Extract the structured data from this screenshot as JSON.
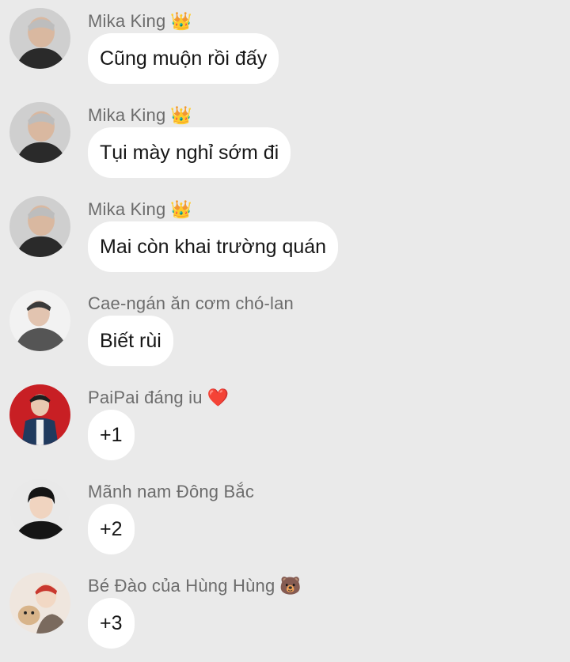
{
  "messages": [
    {
      "sender": "Mika King",
      "badge": "👑",
      "badge_icon": "crown-icon",
      "text": "Cũng muộn rồi đấy",
      "avatar_colors": [
        "#cfcfcf",
        "#2a2a2a",
        "#d9b8a0"
      ]
    },
    {
      "sender": "Mika King",
      "badge": "👑",
      "badge_icon": "crown-icon",
      "text": "Tụi mày nghỉ sớm đi",
      "avatar_colors": [
        "#cfcfcf",
        "#2a2a2a",
        "#d9b8a0"
      ]
    },
    {
      "sender": "Mika King",
      "badge": "👑",
      "badge_icon": "crown-icon",
      "text": "Mai còn khai trường quán",
      "avatar_colors": [
        "#cfcfcf",
        "#2a2a2a",
        "#d9b8a0"
      ]
    },
    {
      "sender": "Cae-ngán ăn cơm chó-lan",
      "badge": "",
      "badge_icon": "",
      "text": "Biết rùi",
      "avatar_colors": [
        "#f2f2f2",
        "#555555",
        "#e2c4b0"
      ]
    },
    {
      "sender": "PaiPai đáng iu",
      "badge": "❤️",
      "badge_icon": "heart-icon",
      "text": "+1",
      "avatar_colors": [
        "#c81f24",
        "#203a5e",
        "#e8c8b0"
      ]
    },
    {
      "sender": "Mãnh nam Đông Bắc",
      "badge": "",
      "badge_icon": "",
      "text": "+2",
      "avatar_colors": [
        "#e9e9e9",
        "#151515",
        "#f0d4c0"
      ]
    },
    {
      "sender": "Bé Đào của Hùng Hùng",
      "badge": "🐻",
      "badge_icon": "bear-icon",
      "text": "+3",
      "avatar_colors": [
        "#efe6de",
        "#c9382e",
        "#f2d8c4"
      ]
    }
  ]
}
